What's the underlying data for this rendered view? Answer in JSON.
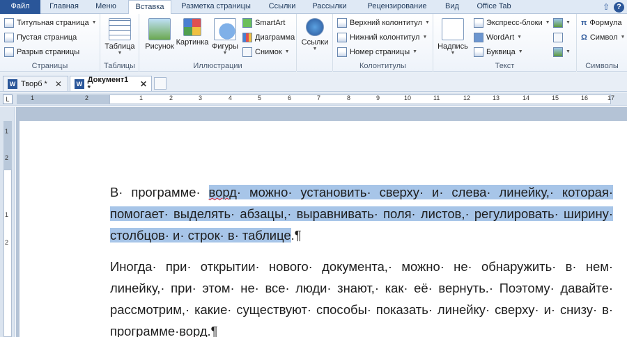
{
  "ribbon_tabs": [
    "Файл",
    "Главная",
    "Меню",
    "Вставка",
    "Разметка страницы",
    "Ссылки",
    "Рассылки",
    "Рецензирование",
    "Вид",
    "Office Tab"
  ],
  "help_icons": [
    "minimize-ribbon-icon",
    "help-icon"
  ],
  "groups": {
    "pages": {
      "label": "Страницы",
      "items": [
        "Титульная страница",
        "Пустая страница",
        "Разрыв страницы"
      ]
    },
    "tables": {
      "label": "Таблицы",
      "items": [
        "Таблица"
      ]
    },
    "illustrations": {
      "label": "Иллюстрации",
      "items": [
        "Рисунок",
        "Картинка",
        "Фигуры",
        "SmartArt",
        "Диаграмма",
        "Снимок"
      ]
    },
    "links": {
      "label": "",
      "items": [
        "Ссылки"
      ]
    },
    "headers": {
      "label": "Колонтитулы",
      "items": [
        "Верхний колонтитул",
        "Нижний колонтитул",
        "Номер страницы"
      ]
    },
    "text": {
      "label": "Текст",
      "items": [
        "Надпись",
        "Экспресс-блоки",
        "WordArt",
        "Буквица"
      ]
    },
    "symbols": {
      "label": "Символы",
      "items": [
        "Формула",
        "Символ"
      ]
    }
  },
  "doc_tabs": [
    {
      "label": "Творб *",
      "active": false
    },
    {
      "label": "Документ1 *",
      "active": true
    }
  ],
  "ruler_numbers": [
    "1",
    "2",
    "1",
    "2",
    "3",
    "4",
    "5",
    "6",
    "7",
    "8",
    "9",
    "10",
    "11",
    "12",
    "13",
    "14",
    "15",
    "16",
    "17"
  ],
  "vruler_numbers": [
    "1",
    "2",
    "1",
    "2"
  ],
  "document": {
    "p1_before": "В· программе· ",
    "p1_sel_a": "ворд",
    "p1_sel_b": "· можно· установить· сверху· и· слева· линейку,· которая· помогает· выделять· абзацы,· выравнивать· поля· листов,· регулировать· ширину· столбцов· и· строк· в· таблице",
    "p1_after": ".¶",
    "p2_main": "Иногда· при· открытии· нового· документа,· можно· не· обнаружить· в· нем· линейку,· при· этом· не· все· люди· знают,· как· её· вернуть.· Поэтому· давайте· рассмотрим,· какие· существуют· способы· показать· линейку· сверху· и· снизу· в· программе·",
    "p2_word": "ворд",
    "p2_end": ".¶"
  }
}
